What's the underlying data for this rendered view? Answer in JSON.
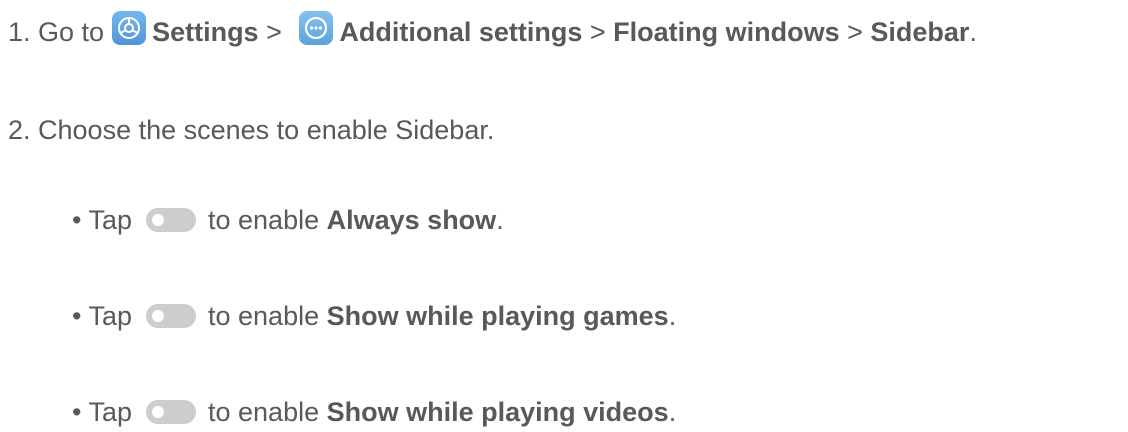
{
  "step1": {
    "prefix": "1. Go to",
    "settings_label": "Settings",
    "sep1": " > ",
    "additional_label": "Additional settings",
    "sep2": " > ",
    "floating_label": "Floating windows",
    "sep3": " > ",
    "sidebar_label": "Sidebar",
    "end": "."
  },
  "step2": {
    "text": "2. Choose the scenes to enable Sidebar."
  },
  "bullets": [
    {
      "prefix": "• Tap",
      "middle": "to enable",
      "option": "Always show",
      "end": "."
    },
    {
      "prefix": "• Tap",
      "middle": "to enable",
      "option": "Show while playing games",
      "end": "."
    },
    {
      "prefix": "• Tap",
      "middle": "to enable",
      "option": "Show while playing videos",
      "end": "."
    }
  ],
  "icons": {
    "settings": "settings-gear-icon",
    "additional": "additional-settings-icon",
    "toggle": "toggle-switch-icon"
  },
  "colors": {
    "text": "#595959",
    "icon_blue": "#5aa3dc",
    "toggle_off": "#cdcdcd"
  }
}
